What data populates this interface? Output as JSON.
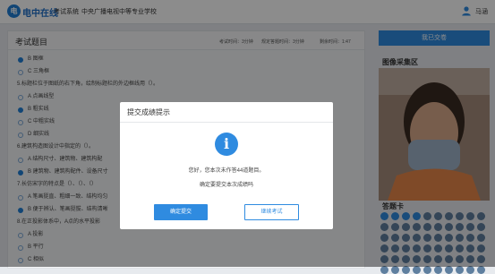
{
  "header": {
    "logo_text": "电中在线",
    "logo_badge": "电",
    "nav": [
      "考试系统",
      "中央广播电视中等专业学校"
    ],
    "user_name": "马涵"
  },
  "main": {
    "title": "考试题目",
    "time_limit": "考试时间：3分钟",
    "answer_time": "规定答题时间：3分钟",
    "remaining": "剩余时间：1:47",
    "lines": [
      {
        "kind": "opt",
        "text": "B 图框",
        "selected": true
      },
      {
        "kind": "opt",
        "text": "C 三角框",
        "selected": false
      },
      {
        "kind": "q",
        "text": "5.标题栏位于图纸的右下角，绘制标题栏的外边框线用（）。"
      },
      {
        "kind": "opt",
        "text": "A 点画线型",
        "selected": false
      },
      {
        "kind": "opt",
        "text": "B 粗实线",
        "selected": true
      },
      {
        "kind": "opt",
        "text": "C 中粗实线",
        "selected": false
      },
      {
        "kind": "opt",
        "text": "D 细实线",
        "selected": false
      },
      {
        "kind": "q",
        "text": "6.建筑构造图设计中指定的（）。"
      },
      {
        "kind": "opt",
        "text": "A 结构尺寸、建筑物、建筑构配",
        "selected": false
      },
      {
        "kind": "opt",
        "text": "B 建筑物、建筑构配件、设备尺寸",
        "selected": true
      },
      {
        "kind": "q",
        "text": "7.长仿宋字的特点是（）、（）、（）"
      },
      {
        "kind": "opt",
        "text": "A 笔画挺直、粗细一致、结构均匀",
        "selected": false
      },
      {
        "kind": "opt",
        "text": "B 便于辨认、笔画挺拔、结构清晰",
        "selected": true
      },
      {
        "kind": "q",
        "text": "8.在正投影体系中，A点的水平投影"
      },
      {
        "kind": "opt",
        "text": "A 投影",
        "selected": false
      },
      {
        "kind": "opt",
        "text": "B 平行",
        "selected": false
      },
      {
        "kind": "opt",
        "text": "C 相似",
        "selected": false
      }
    ]
  },
  "side": {
    "submit_label": "我已交卷",
    "photo_title": "图像采集区",
    "card_title": "答题卡"
  },
  "modal": {
    "title": "提交成绩提示",
    "icon_glyph": "i",
    "message1": "您好，您本次未作答44道题目。",
    "message2": "确定要提交本次成绩吗",
    "confirm_label": "确定提交",
    "cancel_label": "继续考试"
  },
  "colors": {
    "accent": "#2f8be0",
    "overlay": "rgba(0,0,0,0.45)"
  }
}
